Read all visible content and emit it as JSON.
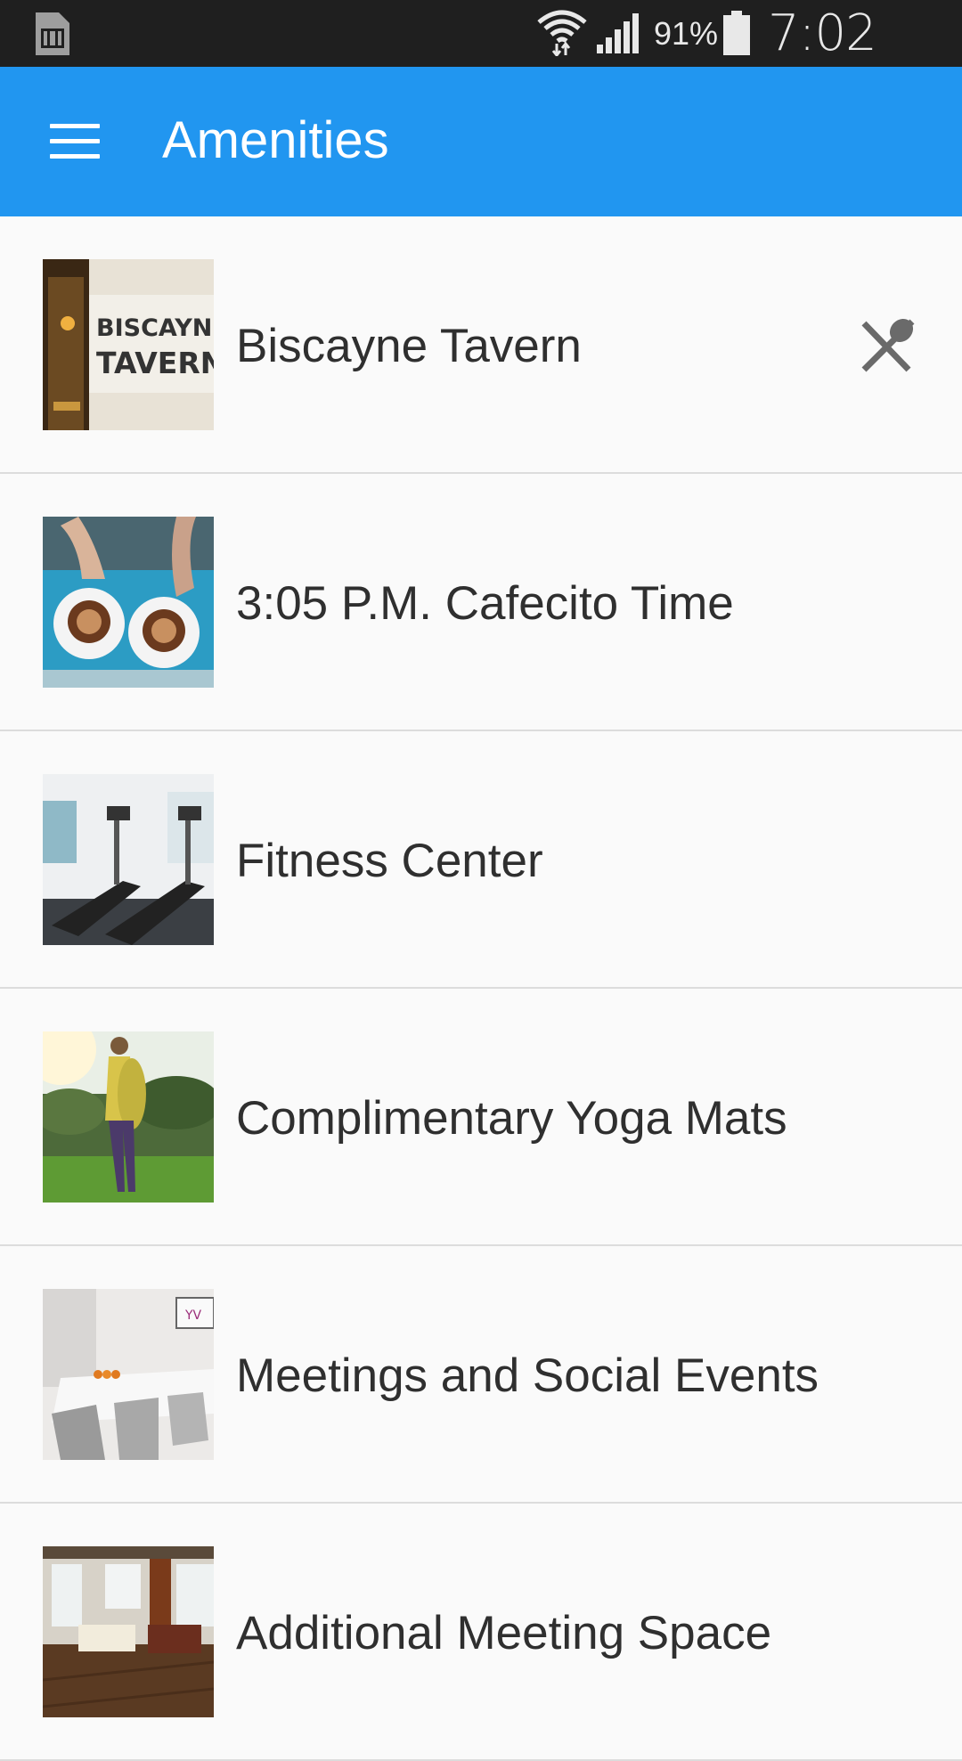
{
  "status_bar": {
    "battery_percent": "91%",
    "time": "7:02 AM",
    "icons": [
      "sim-card-icon",
      "wifi-icon",
      "signal-icon",
      "battery-icon"
    ]
  },
  "app_bar": {
    "title": "Amenities",
    "menu_icon": "hamburger-menu-icon",
    "background_color": "#2196f0"
  },
  "amenities": [
    {
      "label": "Biscayne Tavern",
      "thumbnail": "tavern-sign-photo",
      "thumbnail_text": [
        "BISCAYNE",
        "TAVERN"
      ],
      "trailing_icon": "restaurant-icon"
    },
    {
      "label": "3:05 P.M. Cafecito Time",
      "thumbnail": "coffee-cups-photo"
    },
    {
      "label": "Fitness Center",
      "thumbnail": "treadmills-photo"
    },
    {
      "label": "Complimentary Yoga Mats",
      "thumbnail": "yoga-woman-park-photo"
    },
    {
      "label": "Meetings and Social Events",
      "thumbnail": "meeting-room-photo",
      "thumbnail_text": [
        "YV"
      ]
    },
    {
      "label": "Additional Meeting Space",
      "thumbnail": "lounge-room-photo"
    }
  ]
}
